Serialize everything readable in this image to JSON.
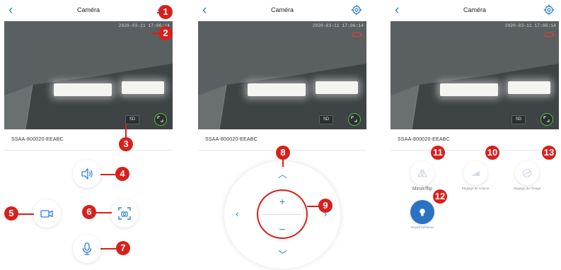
{
  "screens": [
    {
      "title": "Caméra",
      "timestamp": "2020-03-11 17:06:14",
      "sd_label": "SD",
      "device_name": "SSAA-800020-EEABC"
    },
    {
      "title": "Caméra",
      "timestamp": "2020-03-11 17:06:14",
      "sd_label": "SD",
      "device_name": "SSAA-800020-EEABC",
      "zoom_in": "+",
      "zoom_out": "–"
    },
    {
      "title": "Caméra",
      "timestamp": "2020-03-11 17:06:14",
      "sd_label": "SD",
      "device_name": "SSAA-800020-EEABC",
      "functions": {
        "mirror": "Miroir/flip",
        "volume": "Réglage du volume",
        "image": "Réglage de l'image",
        "indicator": "Voyant lumineux"
      }
    }
  ],
  "callouts": [
    "1",
    "2",
    "3",
    "4",
    "5",
    "6",
    "7",
    "8",
    "9",
    "10",
    "11",
    "12",
    "13"
  ],
  "colors": {
    "accent": "#2a7fd4",
    "callout": "#d8201c",
    "active": "#2a73c2"
  },
  "icons": [
    "back-icon",
    "gear-icon",
    "battery-icon",
    "fullscreen-icon",
    "speaker-icon",
    "record-icon",
    "screenshot-icon",
    "microphone-icon",
    "chevron-up-icon",
    "chevron-down-icon",
    "chevron-left-icon",
    "chevron-right-icon",
    "mirror-icon",
    "volume-icon",
    "image-adjust-icon",
    "bulb-icon"
  ]
}
